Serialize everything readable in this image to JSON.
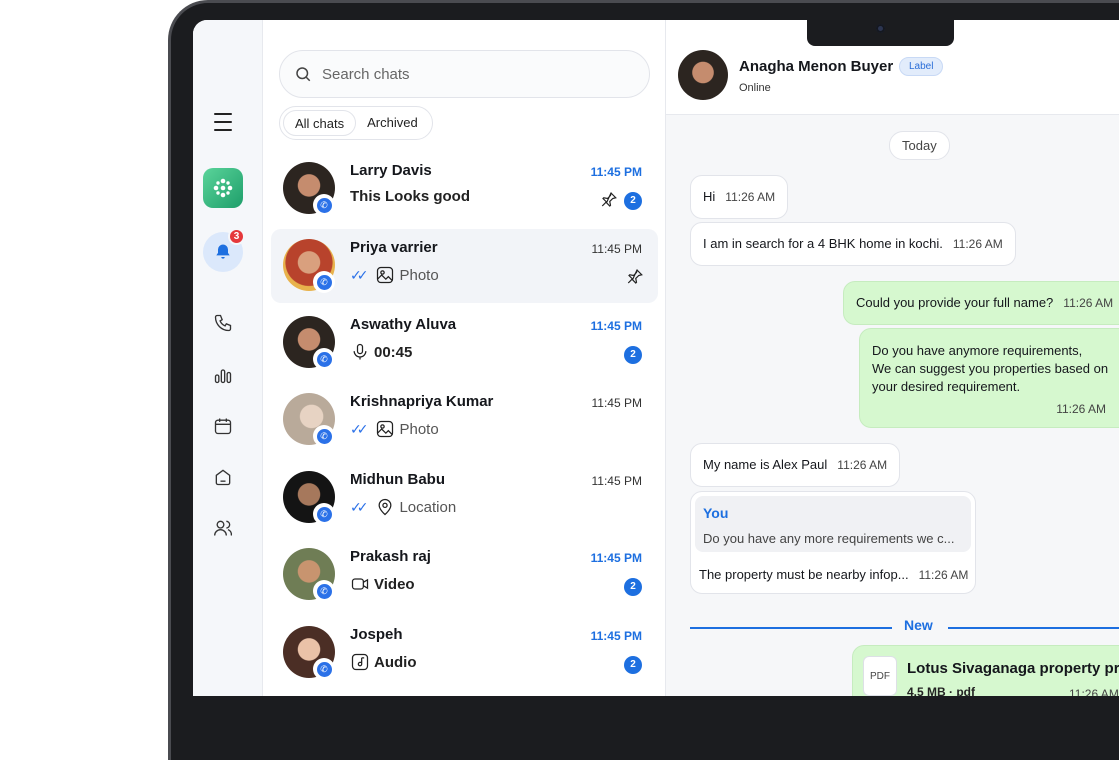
{
  "rail": {
    "notification_count": "3"
  },
  "list": {
    "search_placeholder": "Search chats",
    "filters": [
      "All chats",
      "Archived"
    ],
    "chats": [
      {
        "name": "Larry Davis",
        "preview": "This Looks good",
        "time": "11:45 PM",
        "unread": "2"
      },
      {
        "name": "Priya varrier",
        "preview": "Photo",
        "time": "11:45 PM"
      },
      {
        "name": "Aswathy Aluva",
        "preview": "00:45",
        "time": "11:45 PM",
        "unread": "2"
      },
      {
        "name": "Krishnapriya Kumar",
        "preview": "Photo",
        "time": "11:45 PM"
      },
      {
        "name": "Midhun Babu",
        "preview": "Location",
        "time": "11:45 PM"
      },
      {
        "name": "Prakash raj",
        "preview": "Video",
        "time": "11:45 PM",
        "unread": "2"
      },
      {
        "name": "Jospeh",
        "preview": "Audio",
        "time": "11:45 PM",
        "unread": "2"
      }
    ]
  },
  "conversation": {
    "contact_name": "Anagha Menon Buyer",
    "label": "Label",
    "status": "Online",
    "date_divider": "Today",
    "messages": [
      {
        "text": "Hi",
        "time": "11:26 AM"
      },
      {
        "text": "I am in search for a 4 BHK home in kochi.",
        "time": "11:26 AM"
      },
      {
        "text": "Could you provide your full name?",
        "time": "11:26 AM"
      },
      {
        "line1": "Do you have anymore requirements,",
        "line2": "We can suggest you properties based on",
        "line3": "your desired requirement.",
        "time": "11:26 AM"
      },
      {
        "text": "My name is Alex Paul",
        "time": "11:26 AM"
      },
      {
        "reply_to": "You",
        "reply_text": "Do you have any more requirements we c...",
        "text": "The property must be nearby infop...",
        "time": "11:26 AM"
      }
    ],
    "new_divider": "New",
    "file": {
      "name": "Lotus Sivaganaga property pri",
      "meta": "4.5 MB · pdf",
      "type": "PDF",
      "time": "11:26 AM"
    }
  }
}
